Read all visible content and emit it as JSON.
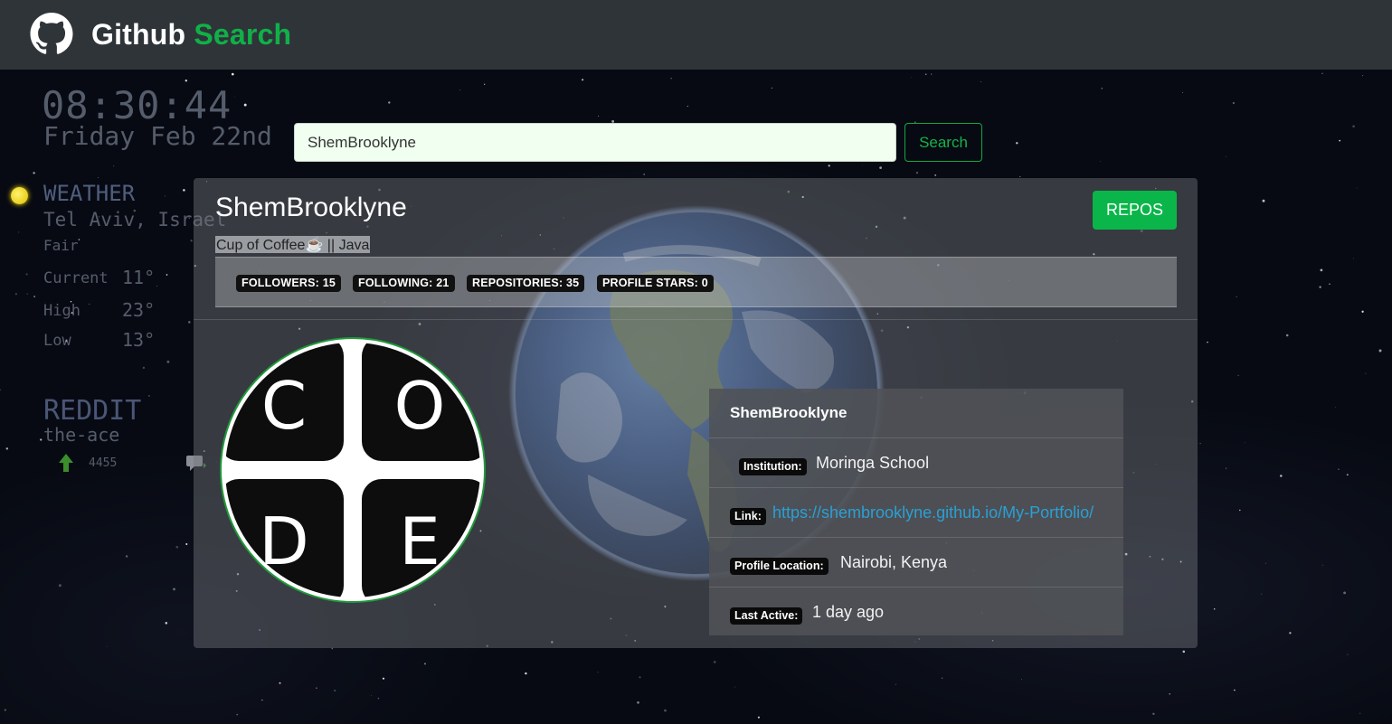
{
  "navbar": {
    "brand_main": "Github",
    "brand_accent": "Search",
    "logo_icon": "github-octocat-icon"
  },
  "desktop": {
    "clock": {
      "time": "08:30:44",
      "date": "Friday Feb 22nd"
    },
    "weather": {
      "title": "WEATHER",
      "city": "Tel Aviv, Israel",
      "condition": "Fair",
      "current_label": "Current",
      "current_value": "11°",
      "high_label": "High",
      "high_value": "23°",
      "low_label": "Low",
      "low_value": "13°"
    },
    "reddit": {
      "title": "REDDIT",
      "user": "the-ace",
      "score": "4455"
    }
  },
  "search": {
    "value": "ShemBrooklyne",
    "button_label": "Search"
  },
  "profile": {
    "username": "ShemBrooklyne",
    "bio": "Cup of Coffee☕ || Java",
    "repos_button": "REPOS",
    "stats": {
      "followers": "FOLLOWERS: 15",
      "following": "FOLLOWING: 21",
      "repositories": "REPOSITORIES: 35",
      "stars": "PROFILE STARS: 0"
    },
    "avatar_letters": [
      "C",
      "O",
      "D",
      "E"
    ],
    "details": {
      "name": "ShemBrooklyne",
      "institution_label": "Institution:",
      "institution": "Moringa School",
      "link_label": "Link:",
      "link": "https://shembrooklyne.github.io/My-Portfolio/",
      "location_label": "Profile Location:",
      "location": "Nairobi, Kenya",
      "last_active_label": "Last Active:",
      "last_active": "1 day ago"
    }
  },
  "colors": {
    "navbar_bg": "#2f3439",
    "accent_green": "#10b048",
    "link_blue": "#2aa0d4"
  }
}
